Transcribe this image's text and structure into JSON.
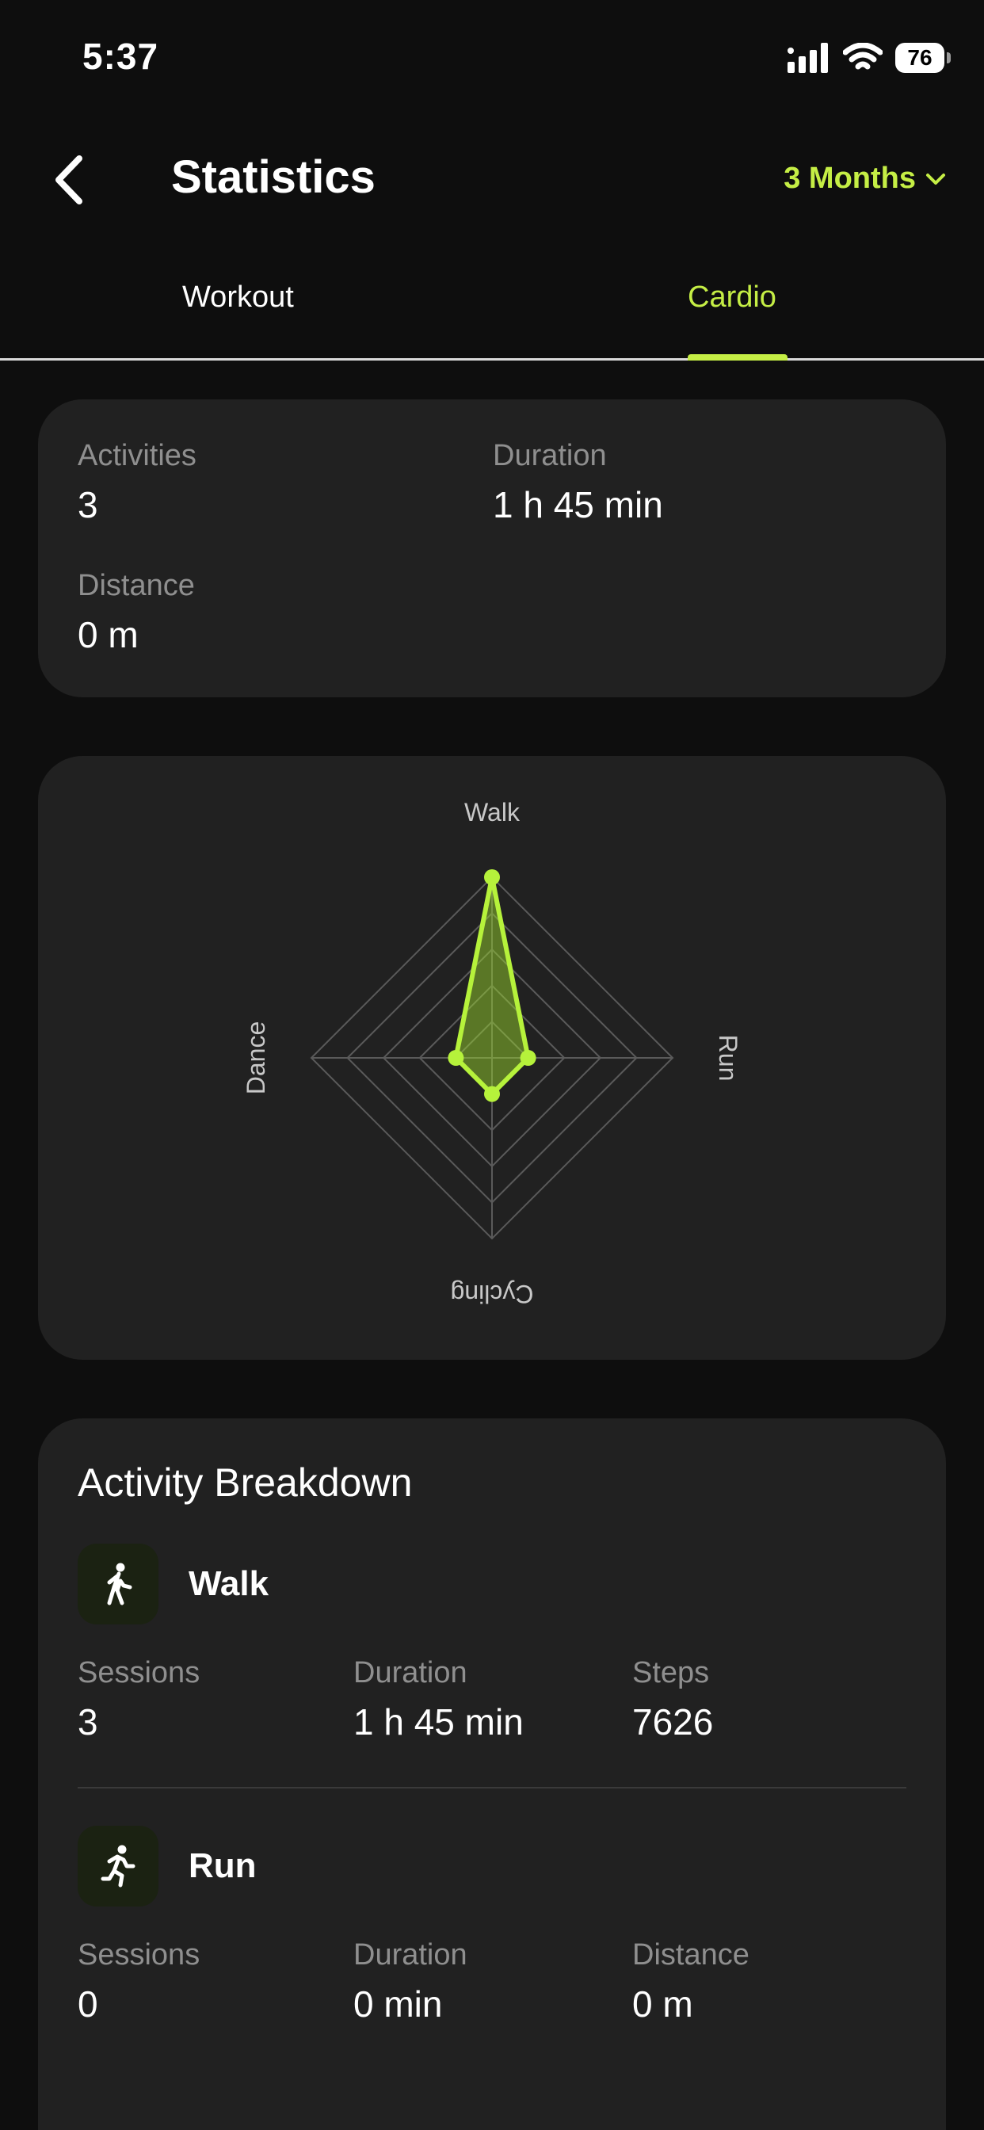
{
  "status_bar": {
    "time": "5:37",
    "battery": "76",
    "signal_icon": "cellular-signal-icon",
    "wifi_icon": "wifi-icon"
  },
  "header": {
    "back_icon": "chevron-left-icon",
    "title": "Statistics",
    "range_label": "3 Months",
    "range_icon": "chevron-down-icon"
  },
  "tabs": [
    {
      "label": "Workout",
      "active": false
    },
    {
      "label": "Cardio",
      "active": true
    }
  ],
  "summary": {
    "activities_label": "Activities",
    "activities_value": "3",
    "duration_label": "Duration",
    "duration_value": "1 h 45 min",
    "distance_label": "Distance",
    "distance_value": "0 m"
  },
  "chart_data": {
    "type": "radar",
    "axes": [
      "Walk",
      "Run",
      "Cycling",
      "Dance"
    ],
    "values": [
      1.0,
      0.2,
      0.2,
      0.2
    ],
    "rings": 5,
    "accent": "#b6f23b"
  },
  "breakdown": {
    "title": "Activity Breakdown",
    "items": [
      {
        "name": "Walk",
        "icon": "walking-person-icon",
        "stats": [
          {
            "label": "Sessions",
            "value": "3"
          },
          {
            "label": "Duration",
            "value": "1 h 45 min"
          },
          {
            "label": "Steps",
            "value": "7626"
          }
        ]
      },
      {
        "name": "Run",
        "icon": "running-person-icon",
        "stats": [
          {
            "label": "Sessions",
            "value": "0"
          },
          {
            "label": "Duration",
            "value": "0 min"
          },
          {
            "label": "Distance",
            "value": "0 m"
          }
        ]
      }
    ]
  },
  "colors": {
    "background": "#0e0e0e",
    "card": "#212121",
    "accent": "#c5ee45",
    "muted_text": "#8f8f8f"
  }
}
